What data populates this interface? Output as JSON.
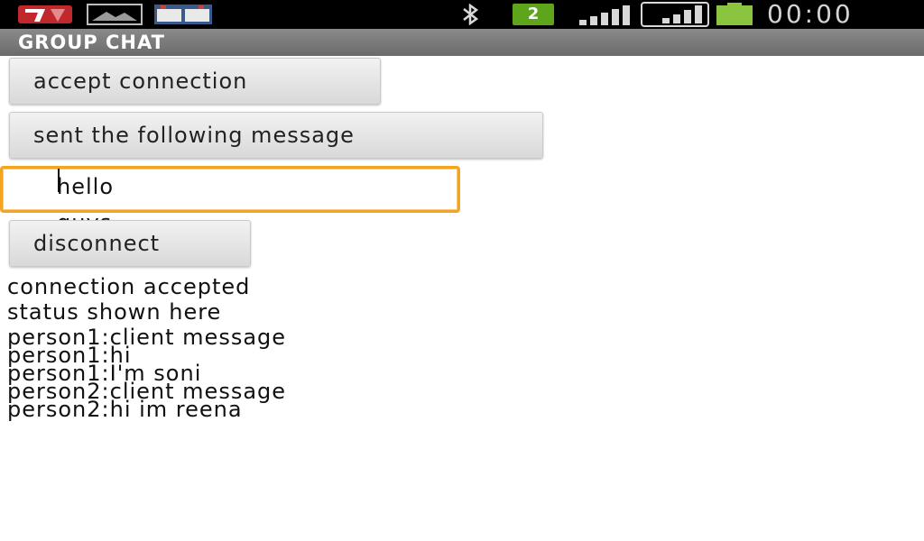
{
  "status_bar": {
    "notification_icons": [
      "app-notification-icon",
      "image-icon",
      "calendar-icon"
    ],
    "bluetooth_icon": "bluetooth-icon",
    "badge": "2",
    "signal_icons": [
      "signal-icon",
      "signal-icon"
    ],
    "battery_icon": "battery-icon",
    "battery_color": "#8bc53f",
    "time": "00:00"
  },
  "title_bar": {
    "title": "GROUP CHAT"
  },
  "buttons": {
    "accept": "accept connection",
    "send": "sent the following message",
    "disconnect": "disconnect"
  },
  "message_input": {
    "value": "hello guys",
    "accent_color": "#f5a41d"
  },
  "status_text": {
    "connection": "connection accepted",
    "status": "status shown here"
  },
  "chat_log": [
    "person1:client message",
    "person1:hi",
    "person1:I'm soni",
    "person2:client message",
    "person2:hi im reena"
  ]
}
